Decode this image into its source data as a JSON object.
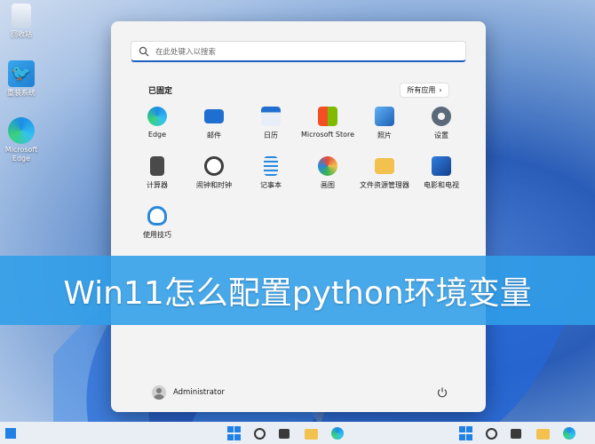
{
  "desktop": {
    "icons": [
      {
        "label": "回收站",
        "icon": "recycle-bin-icon"
      },
      {
        "label": "重装系统",
        "icon": "bird-app-icon"
      },
      {
        "label": "Microsoft Edge",
        "icon": "edge-icon"
      }
    ]
  },
  "start_menu": {
    "search_placeholder": "在此处键入以搜索",
    "pinned_title": "已固定",
    "all_apps_label": "所有应用",
    "apps": [
      {
        "label": "Edge",
        "icon": "edge-icon",
        "color": "#1b8ce6"
      },
      {
        "label": "邮件",
        "icon": "mail-icon",
        "color": "#1f6fd1"
      },
      {
        "label": "日历",
        "icon": "calendar-icon",
        "color": "#1f6fd1"
      },
      {
        "label": "Microsoft Store",
        "icon": "store-icon",
        "color": "#f25022"
      },
      {
        "label": "照片",
        "icon": "photos-icon",
        "color": "#2a85e0"
      },
      {
        "label": "设置",
        "icon": "gear-icon",
        "color": "#5a6a7a"
      },
      {
        "label": "计算器",
        "icon": "calculator-icon",
        "color": "#4a4a4a"
      },
      {
        "label": "闹钟和时钟",
        "icon": "clock-icon",
        "color": "#3d3d3d"
      },
      {
        "label": "记事本",
        "icon": "notepad-icon",
        "color": "#2b88d8"
      },
      {
        "label": "画图",
        "icon": "paint-icon",
        "color": "#e86a2a"
      },
      {
        "label": "文件资源管理器",
        "icon": "folder-icon",
        "color": "#f2c14e"
      },
      {
        "label": "电影和电视",
        "icon": "movies-icon",
        "color": "#1e5fb4"
      },
      {
        "label": "使用技巧",
        "icon": "tips-icon",
        "color": "#2b88d8"
      }
    ],
    "user_name": "Administrator"
  },
  "banner": {
    "title": "Win11怎么配置python环境变量"
  },
  "colors": {
    "accent": "#1f80e5",
    "banner": "#309ee8"
  }
}
